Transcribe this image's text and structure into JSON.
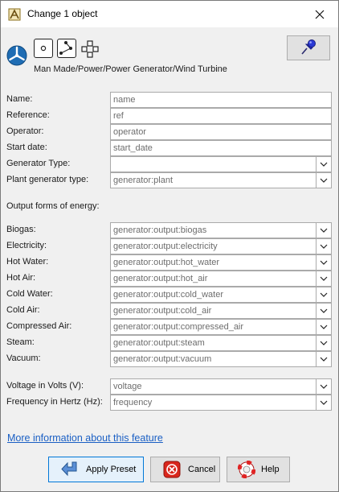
{
  "window": {
    "title": "Change 1 object",
    "icons": {
      "app": "josm-app-icon",
      "close": "close-icon"
    }
  },
  "preset": {
    "path": "Man Made/Power/Power Generator/Wind Turbine",
    "icons": [
      "wind-turbine-icon",
      "node-type-icon",
      "way-type-icon",
      "relation-type-icon"
    ],
    "pin_icon": "pushpin-icon"
  },
  "fields": [
    {
      "label": "Name:",
      "value": "name",
      "kind": "text"
    },
    {
      "label": "Reference:",
      "value": "ref",
      "kind": "text"
    },
    {
      "label": "Operator:",
      "value": "operator",
      "kind": "text"
    },
    {
      "label": "Start date:",
      "value": "start_date",
      "kind": "text"
    },
    {
      "label": "Generator Type:",
      "value": "",
      "kind": "combo"
    },
    {
      "label": "Plant generator type:",
      "value": "generator:plant",
      "kind": "combo"
    }
  ],
  "output_section": {
    "label": "Output forms of energy:",
    "fields": [
      {
        "label": "Biogas:",
        "value": "generator:output:biogas"
      },
      {
        "label": "Electricity:",
        "value": "generator:output:electricity"
      },
      {
        "label": "Hot Water:",
        "value": "generator:output:hot_water"
      },
      {
        "label": "Hot Air:",
        "value": "generator:output:hot_air"
      },
      {
        "label": "Cold Water:",
        "value": "generator:output:cold_water"
      },
      {
        "label": "Cold Air:",
        "value": "generator:output:cold_air"
      },
      {
        "label": "Compressed Air:",
        "value": "generator:output:compressed_air"
      },
      {
        "label": "Steam:",
        "value": "generator:output:steam"
      },
      {
        "label": "Vacuum:",
        "value": "generator:output:vacuum"
      }
    ]
  },
  "electrical": [
    {
      "label": "Voltage in Volts (V):",
      "value": "voltage"
    },
    {
      "label": "Frequency in Hertz (Hz):",
      "value": "frequency"
    }
  ],
  "more_info_link": "More information about this feature",
  "buttons": {
    "apply": "Apply Preset",
    "cancel": "Cancel",
    "help": "Help"
  },
  "colors": {
    "link": "#1a5fc4",
    "accent": "#0078d7",
    "cancel_red": "#d9261c"
  }
}
